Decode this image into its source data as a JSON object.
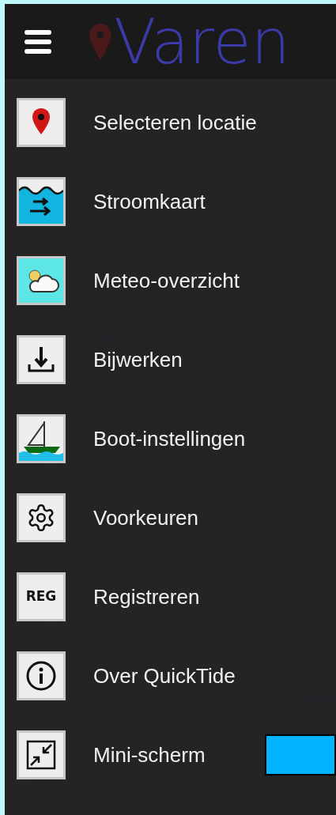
{
  "header": {
    "title": "Varen"
  },
  "menu": {
    "items": [
      {
        "kind": "pin",
        "label": "Selecteren locatie"
      },
      {
        "kind": "current",
        "label": "Stroomkaart"
      },
      {
        "kind": "meteo",
        "label": "Meteo-overzicht"
      },
      {
        "kind": "download",
        "label": "Bijwerken"
      },
      {
        "kind": "boat",
        "label": "Boot-instellingen"
      },
      {
        "kind": "gear",
        "label": "Voorkeuren"
      },
      {
        "kind": "reg",
        "label": "Registreren",
        "icon_text": "REG"
      },
      {
        "kind": "info",
        "label": "Over QuickTide"
      },
      {
        "kind": "shrink",
        "label": "Mini-scherm"
      }
    ]
  }
}
